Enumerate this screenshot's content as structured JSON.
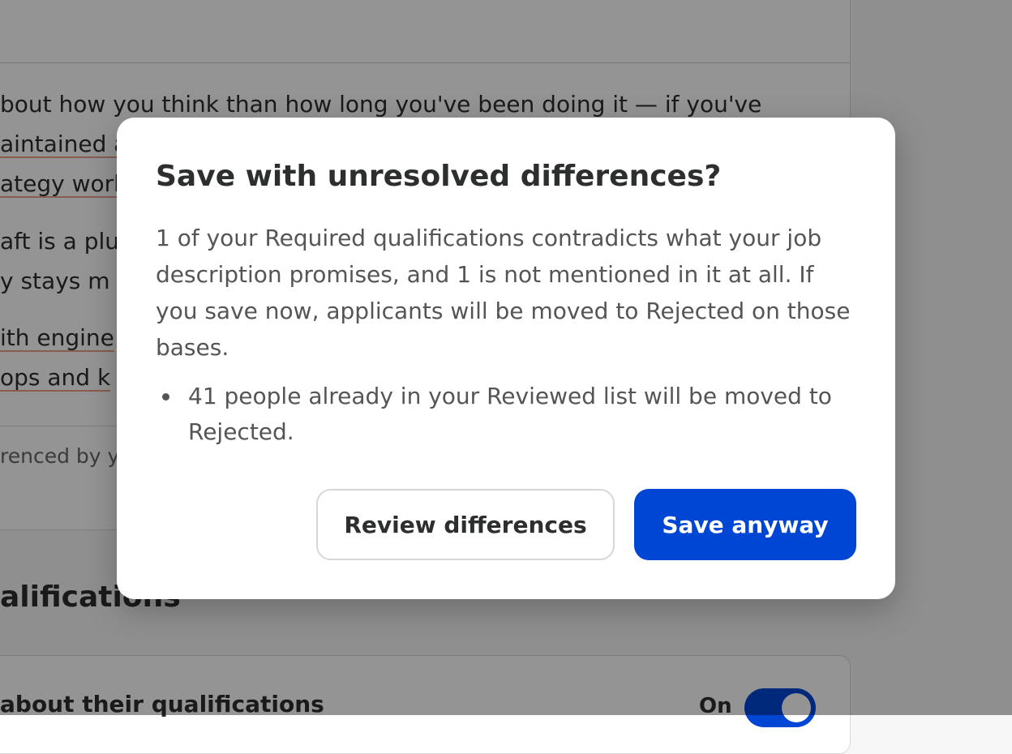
{
  "background": {
    "paragraph_lines": [
      "bout how you think than how long you've been doing it — if you've",
      "aintained a",
      "ategy work",
      "aft is a plu",
      "y stays m",
      "ith engine",
      "ops and k"
    ],
    "footnote": "renced by y",
    "section_heading": "alifications",
    "card_label": "about their qualifications",
    "toggle_label": "On"
  },
  "modal": {
    "title": "Save with unresolved differences?",
    "body": "1 of your Required qualifications contradicts what your job description promises, and 1 is not mentioned in it at all. If you save now, applicants will be moved to Rejected on those bases.",
    "bullets": [
      "41 people already in your Reviewed list will be moved to Rejected."
    ],
    "secondary_button": "Review differences",
    "primary_button": "Save anyway"
  },
  "colors": {
    "primary": "#0046d5",
    "overlay": "rgba(0,0,0,0.42)",
    "spellcheck_underline": "#e8a08a"
  }
}
